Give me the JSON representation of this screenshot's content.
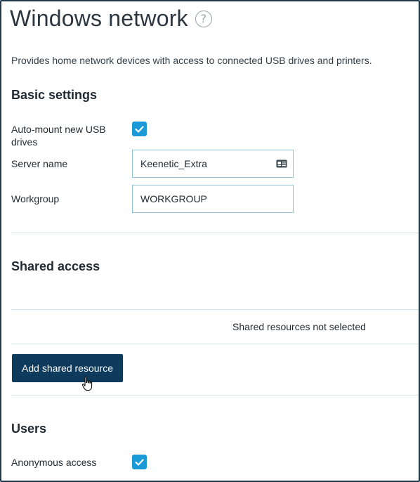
{
  "page": {
    "title": "Windows network",
    "help_icon": "question-circle-icon",
    "description": "Provides home network devices with access to connected USB drives and printers."
  },
  "basic_settings": {
    "title": "Basic settings",
    "auto_mount_label_line1": "Auto-mount new USB",
    "auto_mount_label_line2": "drives",
    "auto_mount_checked": true,
    "server_name_label": "Server name",
    "server_name_value": "Keenetic_Extra",
    "server_name_icon": "contact-card-icon",
    "workgroup_label": "Workgroup",
    "workgroup_value": "WORKGROUP"
  },
  "shared_access": {
    "title": "Shared access",
    "empty_text": "Shared resources not selected",
    "add_button_label": "Add shared resource"
  },
  "users": {
    "title": "Users",
    "anonymous_label": "Anonymous access",
    "anonymous_checked": true
  },
  "colors": {
    "accent": "#1a9bd7",
    "button": "#0e3a5c",
    "divider": "#d6e6ee"
  }
}
